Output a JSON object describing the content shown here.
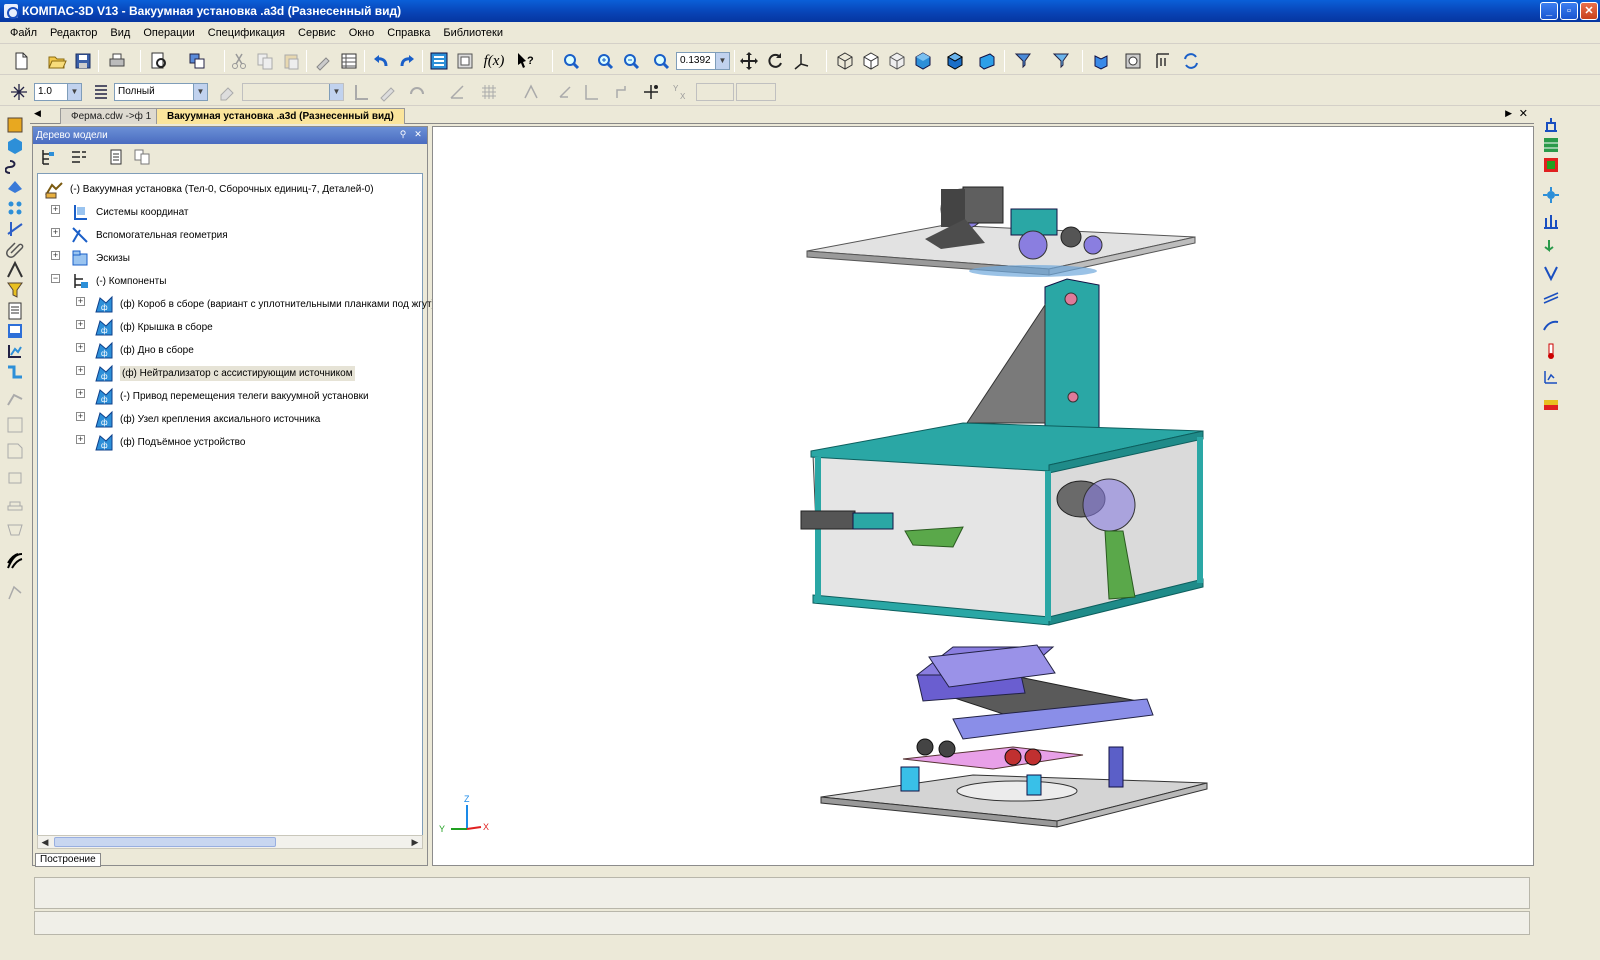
{
  "window": {
    "title": "КОМПАС-3D V13 - Вакуумная установка .a3d (Разнесенный вид)",
    "minimize": "_",
    "maximize": "▫",
    "close": "✕"
  },
  "menu": [
    "Файл",
    "Редактор",
    "Вид",
    "Операции",
    "Спецификация",
    "Сервис",
    "Окно",
    "Справка",
    "Библиотеки"
  ],
  "toolbar": {
    "zoom_value": "0.1392",
    "function_label": "f(x)",
    "step_value": "1.0",
    "display_mode": "Полный"
  },
  "doc_tabs": [
    {
      "label": "Ферма.cdw ->ф 1",
      "active": false
    },
    {
      "label": "Вакуумная установка .a3d (Разнесенный вид)",
      "active": true
    }
  ],
  "tree_panel": {
    "title": "Дерево модели",
    "bottom_tab": "Построение",
    "items": [
      {
        "label": "(-) Вакуумная установка   (Тел-0, Сборочных единиц-7, Деталей-0)",
        "icon": "assembly-root-icon",
        "level": 0
      },
      {
        "label": "Системы координат",
        "icon": "coordinate-system-icon",
        "level": 1
      },
      {
        "label": "Вспомогательная геометрия",
        "icon": "auxiliary-geometry-icon",
        "level": 1
      },
      {
        "label": "Эскизы",
        "icon": "sketches-icon",
        "level": 1
      },
      {
        "label": "(-) Компоненты",
        "icon": "components-icon",
        "level": 1
      },
      {
        "label": "(ф) Короб в сборе    (вариант с уплотнительными планками под жгут)",
        "icon": "subassembly-icon",
        "level": 2
      },
      {
        "label": "(ф) Крышка в сборе",
        "icon": "subassembly-icon",
        "level": 2
      },
      {
        "label": "(ф) Дно в сборе",
        "icon": "subassembly-icon",
        "level": 2
      },
      {
        "label": "(ф) Нейтрализатор с ассистирующим источником",
        "icon": "subassembly-icon",
        "level": 2,
        "selected": true
      },
      {
        "label": "(-) Привод перемещения телеги вакуумной установки",
        "icon": "subassembly-icon",
        "level": 2
      },
      {
        "label": "(ф) Узел крепления аксиального источника",
        "icon": "subassembly-icon",
        "level": 2
      },
      {
        "label": "(ф) Подъёмное устройство",
        "icon": "subassembly-icon",
        "level": 2
      }
    ]
  },
  "axes": {
    "z": "Z",
    "y": "Y",
    "x": "X"
  },
  "colors": {
    "title_bar": "#0842b4",
    "active_tab": "#fbe59c",
    "model_teal": "#2aa7a5",
    "model_purple": "#8a7ee0"
  }
}
